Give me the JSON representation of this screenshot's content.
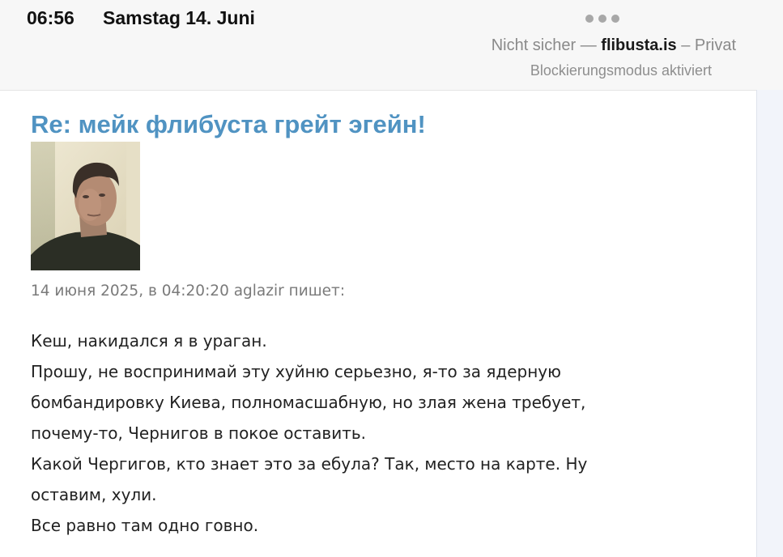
{
  "status_bar": {
    "time": "06:56",
    "date": "Samstag 14. Juni"
  },
  "browser": {
    "menu_icon": "ellipsis-icon",
    "address_prefix": "Nicht sicher — ",
    "domain": "flibusta.is",
    "address_suffix": " – Privat",
    "lockdown_notice": "Blockierungsmodus aktiviert"
  },
  "post": {
    "title": "Re: мейк флибуста грейт эгейн!",
    "avatar": "user-avatar-photo",
    "meta": "14 июня 2025, в 04:20:20 aglazir пишет:",
    "lines": [
      "Кеш, накидался я в ураган.",
      "Прошу, не воспринимай эту хуйню серьезно, я-то за ядерную",
      "бомбандировку Киева, полномасшабную, но злая жена требует,",
      "почему-то, Чернигов в покое оставить.",
      "Какой Чергигов, кто знает это за ебула? Так, место на карте. Ну",
      "оставим, хули.",
      "Все равно там одно говно."
    ]
  },
  "colors": {
    "title": "#5093c2",
    "topbar_bg": "#f7f7f7",
    "scroll_track": "#f2f4fa"
  }
}
